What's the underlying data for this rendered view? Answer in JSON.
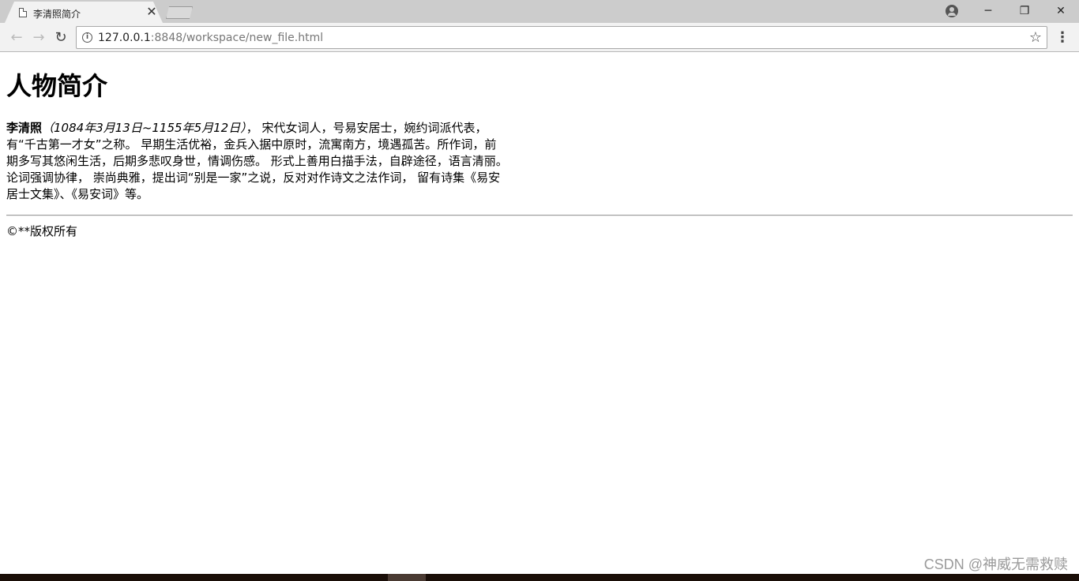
{
  "browser": {
    "tab": {
      "title": "李清照简介",
      "close": "✕"
    },
    "window_controls": {
      "minimize": "─",
      "restore": "❐",
      "close": "✕"
    },
    "toolbar": {
      "back": "←",
      "forward": "→",
      "reload": "↻",
      "info_glyph": "i",
      "url_host": "127.0.0.1",
      "url_rest": ":8848/workspace/new_file.html",
      "bookmark": "☆",
      "menu": "⋮"
    }
  },
  "page": {
    "heading": "人物简介",
    "bio": {
      "name": "李清照",
      "dates": "（1084年3月13日~1155年5月12日）",
      "text": "， 宋代女词人，号易安居士，婉约词派代表，有“千古第一才女”之称。 早期生活优裕，金兵入据中原时，流寓南方，境遇孤苦。所作词，前期多写其悠闲生活，后期多悲叹身世，情调伤感。 形式上善用白描手法，自辟途径，语言清丽。论词强调协律， 崇尚典雅，提出词“别是一家”之说，反对对作诗文之法作词， 留有诗集《易安居士文集》、《易安词》等。"
    },
    "footer": "©**版权所有"
  },
  "watermark": "CSDN @神威无需救赎"
}
